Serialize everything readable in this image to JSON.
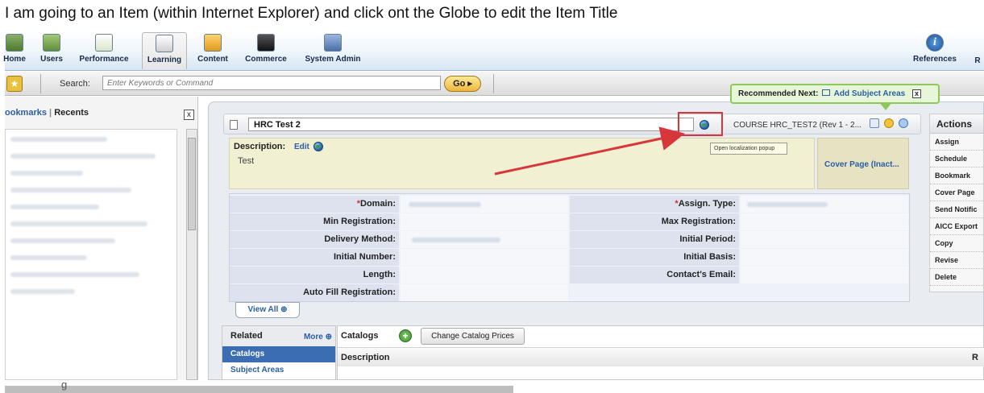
{
  "caption": "I am going to an Item (within Internet Explorer) and click ont the Globe to edit the Item Title",
  "nav": {
    "items": [
      {
        "label": "Home",
        "icon": "home-icon"
      },
      {
        "label": "Users",
        "icon": "users-icon"
      },
      {
        "label": "Performance",
        "icon": "performance-icon"
      },
      {
        "label": "Learning",
        "icon": "learning-icon",
        "active": true
      },
      {
        "label": "Content",
        "icon": "content-icon"
      },
      {
        "label": "Commerce",
        "icon": "commerce-icon"
      },
      {
        "label": "System Admin",
        "icon": "system-admin-icon"
      }
    ],
    "references_label": "References",
    "cutoff_label": "R"
  },
  "search": {
    "label": "Search:",
    "placeholder": "Enter Keywords or Command",
    "go_label": "Go ▸"
  },
  "left_panel": {
    "bookmarks": "ookmarks",
    "separator": "|",
    "recents": "Recents",
    "close": "x"
  },
  "item": {
    "title": "HRC Test 2",
    "course_id": "COURSE HRC_TEST2 (Rev 1 - 2...",
    "tooltip": "Open localization popup",
    "description_label": "Description:",
    "description_edit": "Edit",
    "description_text": "Test",
    "cover_page": "Cover Page (Inact..."
  },
  "recommended": {
    "label": "Recommended Next:",
    "link": "Add Subject Areas",
    "close": "x"
  },
  "fields": {
    "left": [
      {
        "label": "Domain:",
        "required": true
      },
      {
        "label": "Min Registration:",
        "required": false
      },
      {
        "label": "Delivery Method:",
        "required": false
      },
      {
        "label": "Initial Number:",
        "required": false
      },
      {
        "label": "Length:",
        "required": false
      },
      {
        "label": "Auto Fill Registration:",
        "required": false
      }
    ],
    "right": [
      {
        "label": "Assign. Type:",
        "required": true
      },
      {
        "label": "Max Registration:",
        "required": false
      },
      {
        "label": "Initial Period:",
        "required": false
      },
      {
        "label": "Initial Basis:",
        "required": false
      },
      {
        "label": "Contact's Email:",
        "required": false
      }
    ],
    "required_mark": "*",
    "view_all": "View All ⊕"
  },
  "actions": {
    "title": "Actions",
    "items": [
      "Assign",
      "Schedule",
      "Bookmark",
      "Cover Page",
      "Send Notific",
      "AICC Export",
      "Copy",
      "Revise",
      "Delete"
    ]
  },
  "related": {
    "title": "Related",
    "more": "More ⊕",
    "items": [
      {
        "label": "Catalogs",
        "active": true
      },
      {
        "label": "Subject Areas",
        "active": false
      }
    ]
  },
  "catalogs": {
    "title": "Catalogs",
    "add": "+",
    "change_prices": "Change Catalog Prices",
    "column": "Description",
    "right_col": "R",
    "footer_fragment": "g"
  },
  "colors": {
    "annotation_red": "#d8363a",
    "link_blue": "#2a5ea6",
    "recommended_green": "#8cc95a"
  }
}
